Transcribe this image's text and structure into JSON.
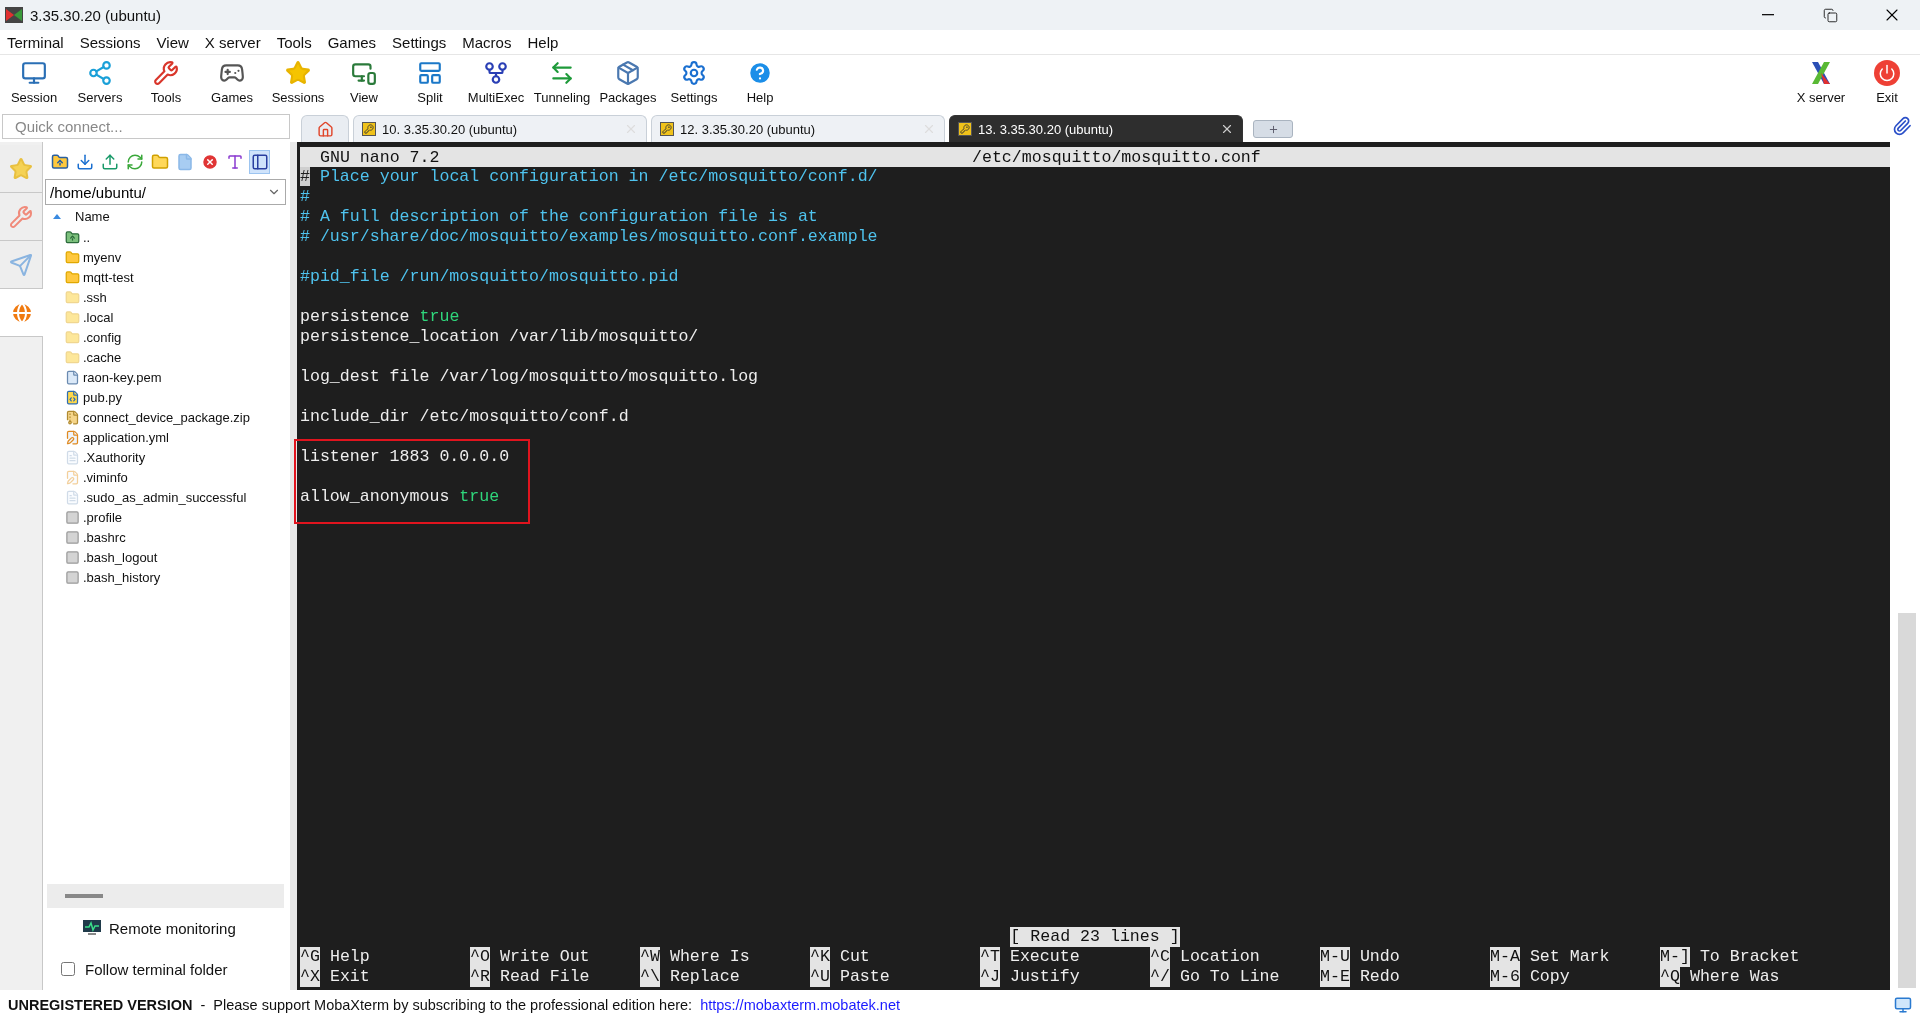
{
  "window": {
    "title": "3.35.30.20 (ubuntu)"
  },
  "menu": [
    "Terminal",
    "Sessions",
    "View",
    "X server",
    "Tools",
    "Games",
    "Settings",
    "Macros",
    "Help"
  ],
  "toolbar": [
    {
      "label": "Session",
      "kind": "session"
    },
    {
      "label": "Servers",
      "kind": "servers"
    },
    {
      "label": "Tools",
      "kind": "tools"
    },
    {
      "label": "Games",
      "kind": "games"
    },
    {
      "label": "Sessions",
      "kind": "sessions"
    },
    {
      "label": "View",
      "kind": "view"
    },
    {
      "label": "Split",
      "kind": "split"
    },
    {
      "label": "MultiExec",
      "kind": "multiexec"
    },
    {
      "label": "Tunneling",
      "kind": "tunneling"
    },
    {
      "label": "Packages",
      "kind": "packages"
    },
    {
      "label": "Settings",
      "kind": "settings"
    },
    {
      "label": "Help",
      "kind": "help"
    }
  ],
  "toolbar_right": [
    {
      "label": "X server",
      "kind": "xserver"
    },
    {
      "label": "Exit",
      "kind": "exit"
    }
  ],
  "quick_connect": {
    "placeholder": "Quick connect..."
  },
  "tabs": [
    {
      "label": "10. 3.35.30.20 (ubuntu)",
      "selected": false
    },
    {
      "label": "12. 3.35.30.20 (ubuntu)",
      "selected": false
    },
    {
      "label": "13. 3.35.30.20 (ubuntu)",
      "selected": true
    }
  ],
  "side_tabs": [
    {
      "kind": "favorites",
      "selected": false
    },
    {
      "kind": "tools",
      "selected": false
    },
    {
      "kind": "send",
      "selected": false
    },
    {
      "kind": "sftp",
      "selected": true
    }
  ],
  "file_browser": {
    "path": "/home/ubuntu/",
    "column": "Name",
    "files": [
      {
        "name": "..",
        "kind": "parent"
      },
      {
        "name": "myenv",
        "kind": "folder"
      },
      {
        "name": "mqtt-test",
        "kind": "folder"
      },
      {
        "name": ".ssh",
        "kind": "hidden-folder"
      },
      {
        "name": ".local",
        "kind": "hidden-folder"
      },
      {
        "name": ".config",
        "kind": "hidden-folder"
      },
      {
        "name": ".cache",
        "kind": "hidden-folder"
      },
      {
        "name": "raon-key.pem",
        "kind": "file"
      },
      {
        "name": "pub.py",
        "kind": "python"
      },
      {
        "name": "connect_device_package.zip",
        "kind": "zip"
      },
      {
        "name": "application.yml",
        "kind": "yaml"
      },
      {
        "name": ".Xauthority",
        "kind": "blank"
      },
      {
        "name": ".viminfo",
        "kind": "yaml-faint"
      },
      {
        "name": ".sudo_as_admin_successful",
        "kind": "blank"
      },
      {
        "name": ".profile",
        "kind": "script"
      },
      {
        "name": ".bashrc",
        "kind": "script"
      },
      {
        "name": ".bash_logout",
        "kind": "script"
      },
      {
        "name": ".bash_history",
        "kind": "script"
      }
    ]
  },
  "remote_monitoring": "Remote monitoring",
  "follow_terminal_folder": {
    "label": "Follow terminal folder",
    "checked": false
  },
  "terminal": {
    "header_left": "GNU nano 7.2",
    "header_right": "/etc/mosquitto/mosquitto.conf",
    "lines": [
      {
        "kind": "comment",
        "text": "# Place your local configuration in /etc/mosquitto/conf.d/",
        "cursor": true
      },
      {
        "kind": "comment",
        "text": "#",
        "cursor": false
      },
      {
        "kind": "comment",
        "text": "# A full description of the configuration file is at",
        "cursor": false
      },
      {
        "kind": "comment",
        "text": "# /usr/share/doc/mosquitto/examples/mosquitto.conf.example",
        "cursor": false
      },
      {
        "kind": "blank",
        "cursor": false
      },
      {
        "kind": "comment",
        "text": "#pid_file /run/mosquitto/mosquitto.pid",
        "cursor": false
      },
      {
        "kind": "blank",
        "cursor": false
      },
      {
        "kind": "setting",
        "text": "persistence",
        "value": "true",
        "cursor": false
      },
      {
        "kind": "plain",
        "text": "persistence_location /var/lib/mosquitto/",
        "cursor": false
      },
      {
        "kind": "blank",
        "cursor": false
      },
      {
        "kind": "plain",
        "text": "log_dest file /var/log/mosquitto/mosquitto.log",
        "cursor": false
      },
      {
        "kind": "blank",
        "cursor": false
      },
      {
        "kind": "plain",
        "text": "include_dir /etc/mosquitto/conf.d",
        "cursor": false
      },
      {
        "kind": "blank",
        "cursor": false
      }
    ],
    "highlighted_lines": [
      {
        "kind": "plain",
        "text": "listener 1883 0.0.0.0"
      },
      {
        "kind": "blank"
      },
      {
        "kind": "setting",
        "text": "allow_anonymous",
        "value": "true"
      }
    ],
    "message": "[ Read 23 lines ]",
    "shortcut_rows": [
      [
        {
          "key": "^G",
          "label": "Help"
        },
        {
          "key": "^O",
          "label": "Write Out"
        },
        {
          "key": "^W",
          "label": "Where Is"
        },
        {
          "key": "^K",
          "label": "Cut"
        },
        {
          "key": "^T",
          "label": "Execute"
        },
        {
          "key": "^C",
          "label": "Location"
        },
        {
          "key": "M-U",
          "label": "Undo"
        },
        {
          "key": "M-A",
          "label": "Set Mark"
        },
        {
          "key": "M-]",
          "label": "To Bracket"
        }
      ],
      [
        {
          "key": "^X",
          "label": "Exit"
        },
        {
          "key": "^R",
          "label": "Read File"
        },
        {
          "key": "^\\",
          "label": "Replace"
        },
        {
          "key": "^U",
          "label": "Paste"
        },
        {
          "key": "^J",
          "label": "Justify"
        },
        {
          "key": "^/",
          "label": "Go To Line"
        },
        {
          "key": "M-E",
          "label": "Redo"
        },
        {
          "key": "M-6",
          "label": "Copy"
        },
        {
          "key": "^Q",
          "label": "Where Was"
        }
      ]
    ]
  },
  "status_bar": {
    "label": "UNREGISTERED VERSION",
    "separator": "-",
    "text": "Please support MobaXterm by subscribing to the professional edition here:",
    "link": "https://mobaxterm.mobatek.net"
  }
}
